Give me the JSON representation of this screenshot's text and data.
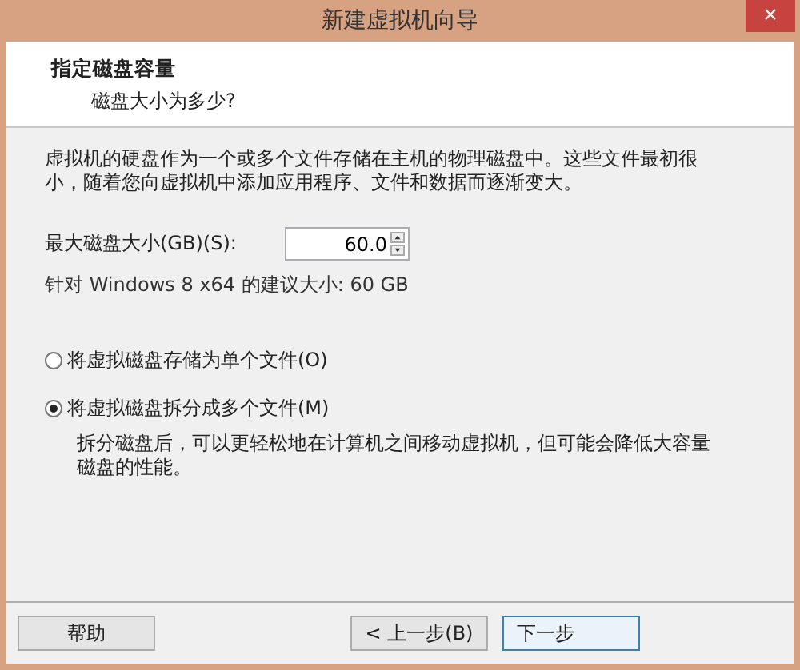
{
  "window": {
    "title": "新建虚拟机向导",
    "close": "×"
  },
  "header": {
    "title": "指定磁盘容量",
    "subtitle": "磁盘大小为多少?"
  },
  "description": "虚拟机的硬盘作为一个或多个文件存储在主机的物理磁盘中。这些文件最初很小，随着您向虚拟机中添加应用程序、文件和数据而逐渐变大。",
  "disk_size": {
    "label": "最大磁盘大小(GB)(S):",
    "value": "60.0"
  },
  "recommendation": "针对 Windows 8 x64 的建议大小: 60 GB",
  "options": [
    {
      "label": "将虚拟磁盘存储为单个文件(O)",
      "selected": false
    },
    {
      "label": "将虚拟磁盘拆分成多个文件(M)",
      "selected": true,
      "note": "拆分磁盘后，可以更轻松地在计算机之间移动虚拟机，但可能会降低大容量磁盘的性能。"
    }
  ],
  "buttons": [
    {
      "label": "帮助",
      "kind": "help"
    },
    {
      "label": "< 上一步(B)",
      "kind": "back"
    },
    {
      "label": "下一步",
      "kind": "next"
    }
  ]
}
